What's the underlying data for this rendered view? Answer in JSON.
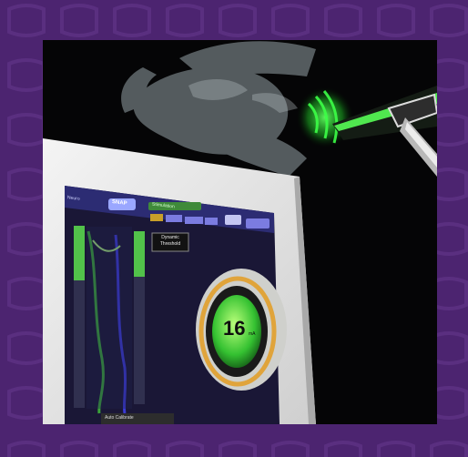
{
  "screen": {
    "menu_text": "Neuro",
    "tab_label": "SNAP",
    "status_text": "Stimulation",
    "label_box": "Dynamic Threshold",
    "readout_value": "16",
    "readout_unit": "mA",
    "bottom_label": "Auto Calibrate"
  },
  "colors": {
    "border_purple": "#4c2470",
    "probe_green": "#39ff4a",
    "dial_ring": "#e0a43b",
    "dial_fill": "#43d13b"
  }
}
